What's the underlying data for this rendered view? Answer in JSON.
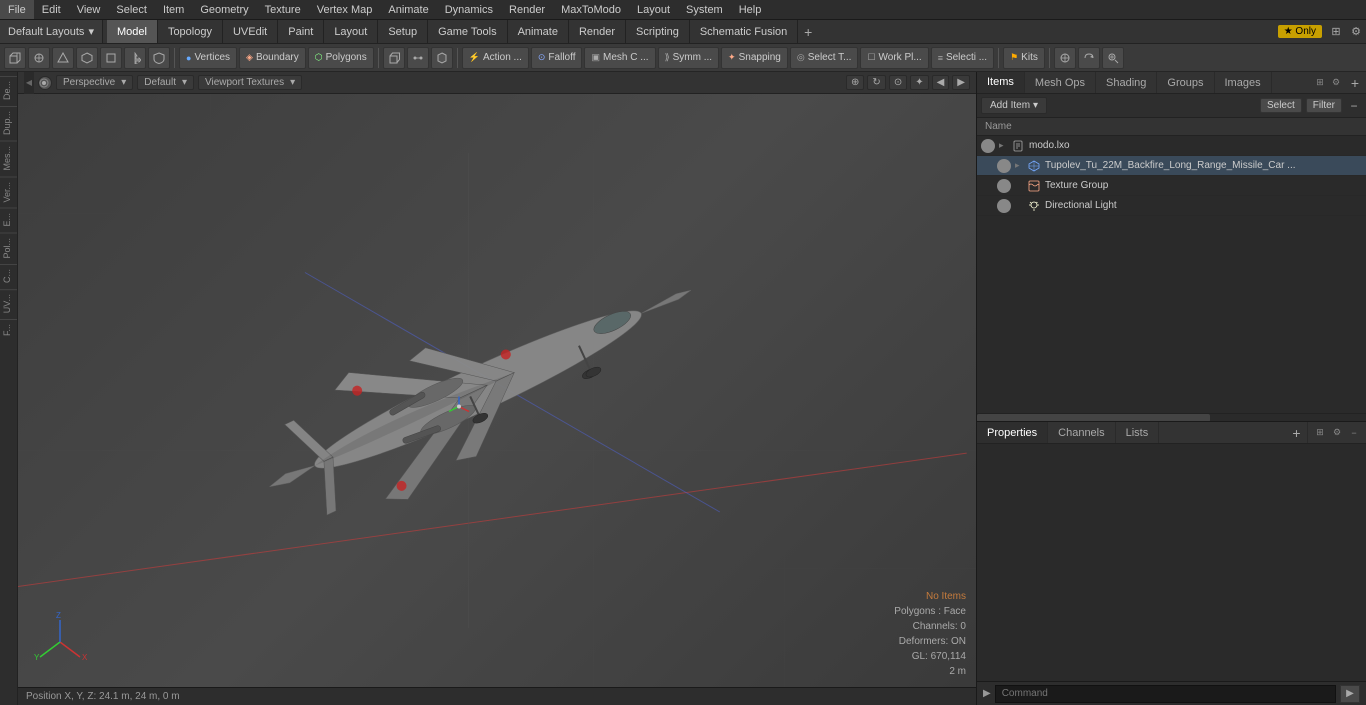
{
  "menubar": {
    "items": [
      "File",
      "Edit",
      "View",
      "Select",
      "Item",
      "Geometry",
      "Texture",
      "Vertex Map",
      "Animate",
      "Dynamics",
      "Render",
      "MaxToModo",
      "Layout",
      "System",
      "Help"
    ]
  },
  "toolbar1": {
    "layout_label": "Default Layouts",
    "layout_arrow": "▾",
    "tabs": [
      {
        "label": "Model",
        "active": true
      },
      {
        "label": "Topology",
        "active": false
      },
      {
        "label": "UVEdit",
        "active": false
      },
      {
        "label": "Paint",
        "active": false
      },
      {
        "label": "Layout",
        "active": false
      },
      {
        "label": "Setup",
        "active": false
      },
      {
        "label": "Game Tools",
        "active": false
      },
      {
        "label": "Animate",
        "active": false
      },
      {
        "label": "Render",
        "active": false
      },
      {
        "label": "Scripting",
        "active": false
      },
      {
        "label": "Schematic Fusion",
        "active": false
      }
    ],
    "add_icon": "+",
    "only_label": "★ Only",
    "expand_icon": "⊞",
    "settings_icon": "⚙"
  },
  "toolbar2": {
    "buttons": [
      {
        "label": "▣",
        "text": "",
        "icon_type": "box"
      },
      {
        "label": "⊕",
        "text": "",
        "icon_type": "circle-plus"
      },
      {
        "label": "△",
        "text": "",
        "icon_type": "triangle"
      },
      {
        "label": "⬡",
        "text": "",
        "icon_type": "hex"
      },
      {
        "label": "◻",
        "text": "",
        "icon_type": "square"
      },
      {
        "label": "◯",
        "text": "",
        "icon_type": "circle"
      },
      {
        "label": "⬛",
        "text": "",
        "icon_type": "shield"
      },
      {
        "label": "● Vertices",
        "text": "Vertices",
        "active": false
      },
      {
        "label": "◈ Boundary",
        "text": "Boundary",
        "active": false
      },
      {
        "label": "⬡ Polygons",
        "text": "Polygons",
        "active": false
      },
      {
        "label": "▣",
        "text": "",
        "icon_type": "box2"
      },
      {
        "label": "○ ●",
        "text": "",
        "icon_type": "dots"
      },
      {
        "label": "⬡",
        "text": "",
        "icon_type": "hex2"
      },
      {
        "label": "⚡ Action ...",
        "text": "Action ...",
        "active": false
      },
      {
        "label": "⊙ Falloff",
        "text": "Falloff",
        "active": false
      },
      {
        "label": "▣ Mesh C ...",
        "text": "Mesh C ...",
        "active": false
      },
      {
        "label": "⟫ Symm ...",
        "text": "Symm ...",
        "active": false
      },
      {
        "label": "✦ Snapping",
        "text": "Snapping",
        "active": false
      },
      {
        "label": "◎ Select T...",
        "text": "Select T...",
        "active": false
      },
      {
        "label": "☐ Work Pl...",
        "text": "Work Pl...",
        "active": false
      },
      {
        "label": "≡ Selecti ...",
        "text": "Selecti ...",
        "active": false
      },
      {
        "label": "⚑ Kits",
        "text": "Kits",
        "active": false
      }
    ],
    "nav_icons": [
      "⊕",
      "⊙",
      "↺"
    ]
  },
  "viewport": {
    "header": {
      "expand_icon": "◀",
      "view_btn": "●",
      "perspective_label": "Perspective",
      "default_label": "Default",
      "viewport_textures_label": "Viewport Textures",
      "nav_icons": [
        "⊕",
        "↻",
        "⊙",
        "✦",
        "◀",
        "▶"
      ]
    },
    "status": {
      "no_items": "No Items",
      "polygons": "Polygons : Face",
      "channels": "Channels: 0",
      "deformers": "Deformers: ON",
      "gl": "GL: 670,114",
      "scale": "2 m"
    },
    "statusbar": {
      "position": "Position X, Y, Z:  24.1 m, 24 m, 0 m"
    }
  },
  "items_panel": {
    "tabs": [
      "Items",
      "Mesh Ops",
      "Shading",
      "Groups",
      "Images"
    ],
    "add_btn": "Add Item",
    "add_dropdown": "▾",
    "select_btn": "Select",
    "filter_btn": "Filter",
    "header": {
      "col_name": "Name"
    },
    "items": [
      {
        "id": 1,
        "level": 0,
        "visible": true,
        "expanded": true,
        "icon": "mesh",
        "name": "modo.lxo",
        "is_file": true
      },
      {
        "id": 2,
        "level": 1,
        "visible": true,
        "expanded": true,
        "icon": "mesh-obj",
        "name": "Tupolev_Tu_22M_Backfire_Long_Range_Missile_Car ...",
        "is_mesh": true
      },
      {
        "id": 3,
        "level": 1,
        "visible": true,
        "expanded": false,
        "icon": "texture",
        "name": "Texture Group",
        "is_texture": true
      },
      {
        "id": 4,
        "level": 1,
        "visible": true,
        "expanded": false,
        "icon": "light",
        "name": "Directional Light",
        "is_light": true
      }
    ]
  },
  "properties_panel": {
    "tabs": [
      "Properties",
      "Channels",
      "Lists"
    ],
    "add_btn": "+"
  },
  "commandbar": {
    "prompt": "▶",
    "placeholder": "Command",
    "run_icon": "▶"
  },
  "left_sidebar": {
    "items": [
      "De...",
      "Dup...",
      "Mes...",
      "Ver...",
      "E...",
      "Pol...",
      "C...",
      "UV...",
      "F..."
    ]
  }
}
